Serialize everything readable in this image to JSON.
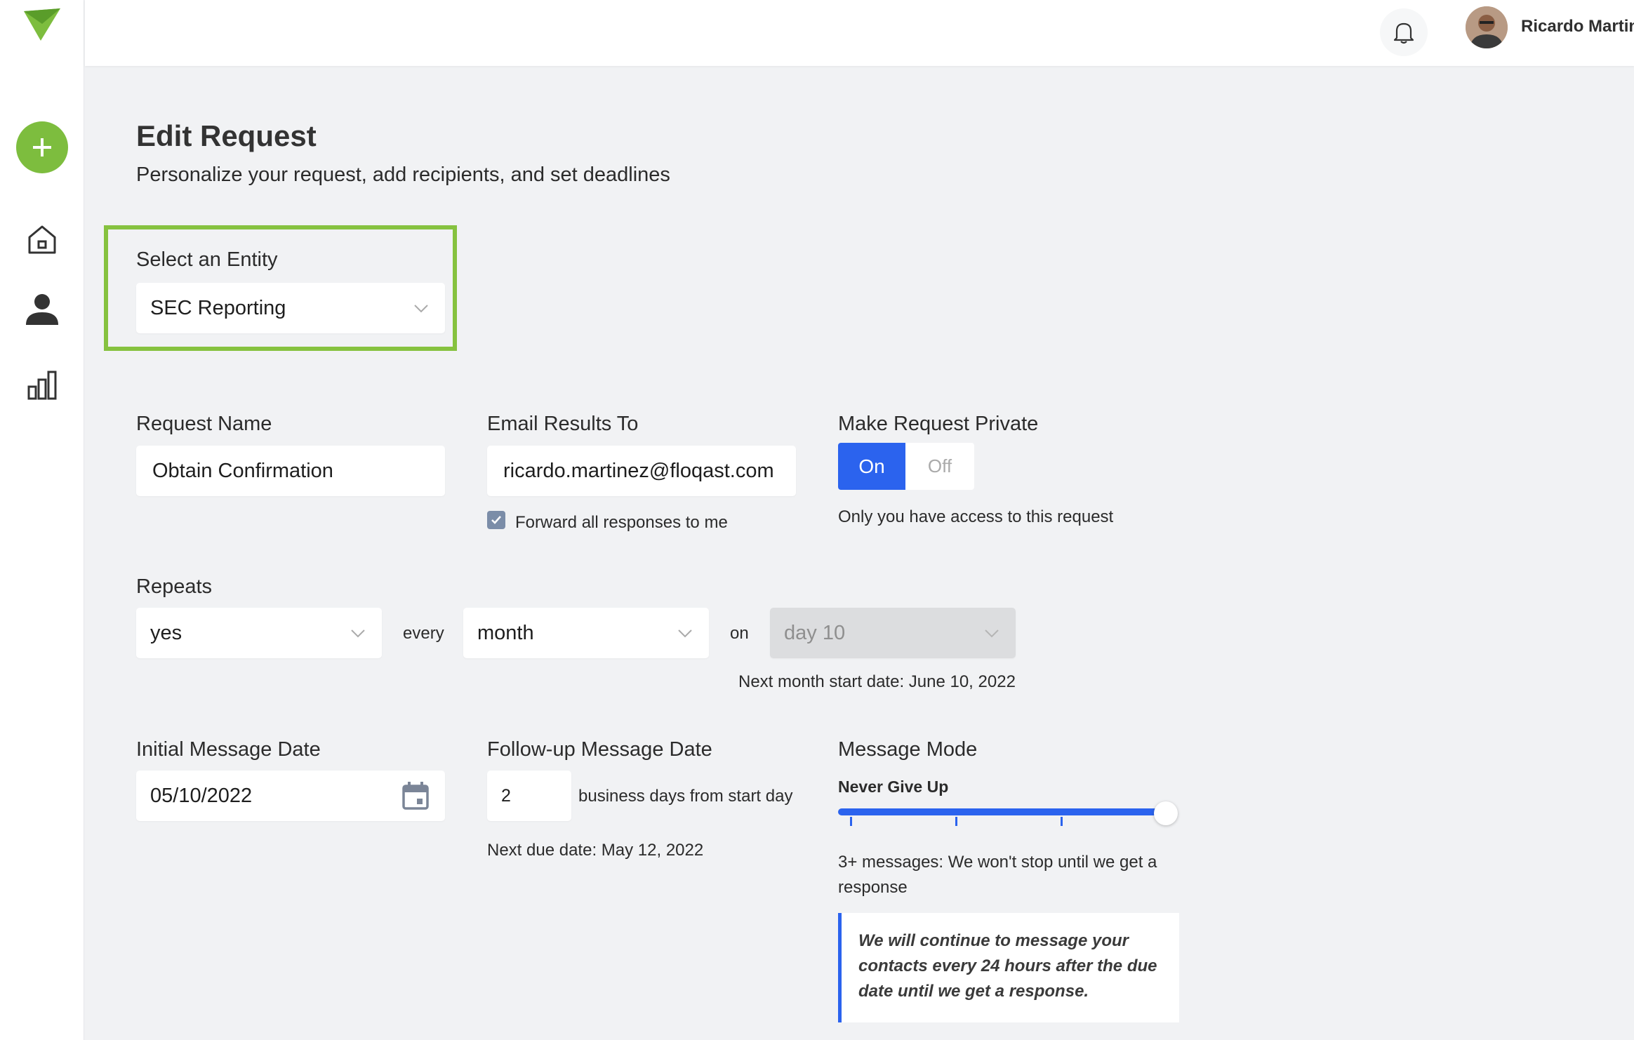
{
  "header": {
    "user_name": "Ricardo Martinez"
  },
  "sidebar": {
    "add_icon": "plus-icon",
    "items": [
      {
        "icon": "home-icon"
      },
      {
        "icon": "person-icon"
      },
      {
        "icon": "bar-chart-icon"
      }
    ]
  },
  "page": {
    "title": "Edit Request",
    "subtitle": "Personalize your request, add recipients, and set deadlines"
  },
  "entity": {
    "label": "Select an Entity",
    "value": "SEC Reporting"
  },
  "request_name": {
    "label": "Request Name",
    "value": "Obtain Confirmation"
  },
  "email_results": {
    "label": "Email Results To",
    "value": "ricardo.martinez@floqast.com",
    "forward_label": "Forward all responses to me",
    "forward_checked": true
  },
  "private": {
    "label": "Make Request Private",
    "on_label": "On",
    "off_label": "Off",
    "selected": "On",
    "note": "Only you have access to this request"
  },
  "repeats": {
    "label": "Repeats",
    "value": "yes",
    "every_label": "every",
    "period": "month",
    "on_label": "on",
    "day": "day 10",
    "next_start": "Next month start date: June 10, 2022"
  },
  "initial_date": {
    "label": "Initial Message Date",
    "value": "05/10/2022"
  },
  "followup": {
    "label": "Follow-up Message Date",
    "value": "2",
    "suffix": "business days from start day",
    "next_due": "Next due date: May 12, 2022"
  },
  "message_mode": {
    "label": "Message Mode",
    "mode_name": "Never Give Up",
    "level": 1.0,
    "description": "3+ messages: We won't stop until we get a response",
    "quote": "We will continue to message your contacts every 24 hours after the due date until we get a response."
  },
  "colors": {
    "accent_green": "#7dbd3e",
    "highlight_green": "#86c23f",
    "primary_blue": "#2b63ee"
  }
}
